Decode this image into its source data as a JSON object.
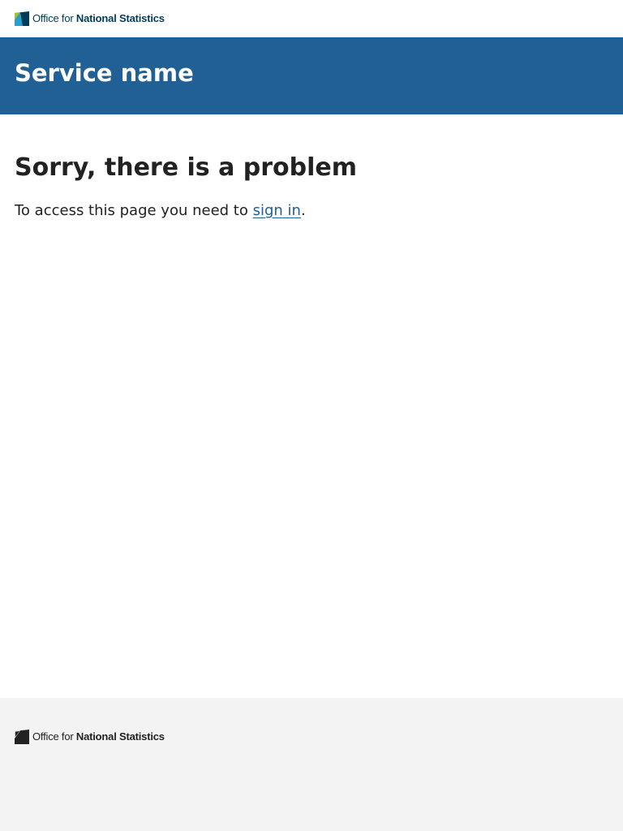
{
  "header": {
    "logo": {
      "icon": "ons-logo-icon",
      "text_light": "Office for ",
      "text_bold": "National Statistics",
      "colors": {
        "primary": "#003c57",
        "accent": "#a8bd3a",
        "blue": "#27a0cc"
      }
    }
  },
  "service": {
    "name": "Service name",
    "background": "#206095"
  },
  "main": {
    "title": "Sorry, there is a problem",
    "text_before": "To access this page you need to ",
    "link_label": "sign in",
    "text_after": "."
  },
  "footer": {
    "logo": {
      "icon": "ons-logo-icon",
      "text_light": "Office for ",
      "text_bold": "National Statistics"
    },
    "background": "#f3f3f3"
  }
}
